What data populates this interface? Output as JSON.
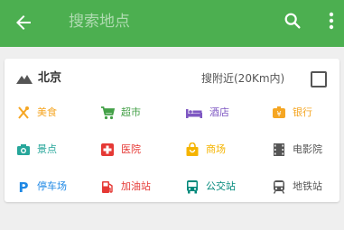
{
  "header": {
    "title_placeholder": "搜索地点",
    "back_icon": "arrow-left-icon",
    "search_icon": "search-icon",
    "menu_icon": "more-vert-icon",
    "background": "#4caf50"
  },
  "location": {
    "city": "北京",
    "nearby_label": "搜附近(20Km内)",
    "nearby_checked": false
  },
  "categories": [
    [
      {
        "label": "美食",
        "icon": "fork-knife-icon",
        "color": "#f5a623"
      },
      {
        "label": "超市",
        "icon": "cart-icon",
        "color": "#43a047"
      },
      {
        "label": "酒店",
        "icon": "bed-icon",
        "color": "#7e57c2"
      },
      {
        "label": "银行",
        "icon": "bank-icon",
        "color": "#f5a623"
      }
    ],
    [
      {
        "label": "景点",
        "icon": "camera-icon",
        "color": "#26a69a"
      },
      {
        "label": "医院",
        "icon": "hospital-icon",
        "color": "#e53935"
      },
      {
        "label": "商场",
        "icon": "shopping-bag-icon",
        "color": "#f5b400"
      },
      {
        "label": "电影院",
        "icon": "film-icon",
        "color": "#555555"
      }
    ],
    [
      {
        "label": "停车场",
        "icon": "parking-icon",
        "color": "#1e88e5"
      },
      {
        "label": "加油站",
        "icon": "gas-station-icon",
        "color": "#e53935"
      },
      {
        "label": "公交站",
        "icon": "bus-icon",
        "color": "#00897b"
      },
      {
        "label": "地铁站",
        "icon": "subway-icon",
        "color": "#555555"
      }
    ]
  ]
}
